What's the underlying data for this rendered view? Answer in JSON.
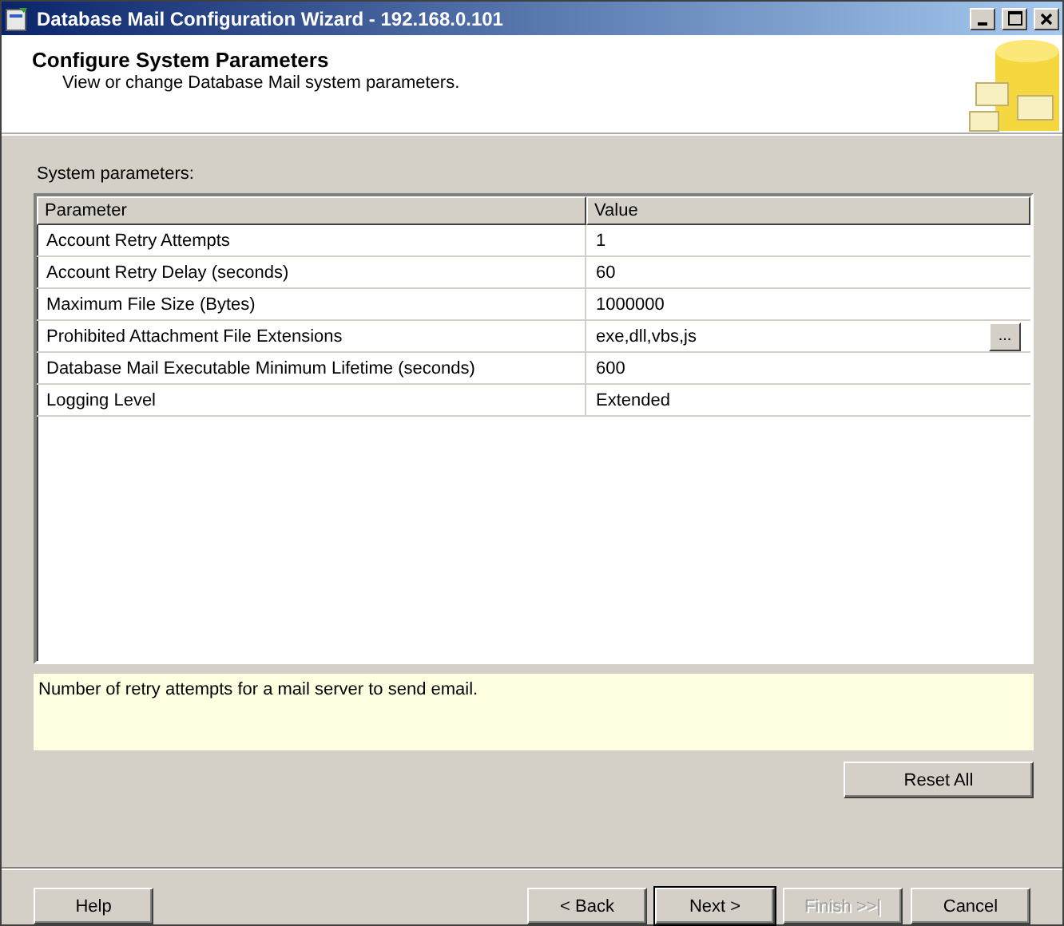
{
  "window": {
    "title": "Database Mail Configuration Wizard - 192.168.0.101"
  },
  "header": {
    "title": "Configure System Parameters",
    "subtitle": "View or change Database Mail system parameters."
  },
  "grid": {
    "label": "System parameters:",
    "columns": [
      "Parameter",
      "Value"
    ],
    "rows": [
      {
        "parameter": "Account Retry Attempts",
        "value": "1"
      },
      {
        "parameter": "Account Retry Delay (seconds)",
        "value": "60"
      },
      {
        "parameter": "Maximum File Size (Bytes)",
        "value": "1000000"
      },
      {
        "parameter": "Prohibited Attachment File Extensions",
        "value": "exe,dll,vbs,js",
        "browse_label": "..."
      },
      {
        "parameter": "Database Mail Executable Minimum Lifetime (seconds)",
        "value": "600"
      },
      {
        "parameter": "Logging Level",
        "value": "Extended"
      }
    ]
  },
  "description": "Number of retry attempts for a mail server to send email.",
  "reset_button": "Reset All",
  "buttons": [
    {
      "label": "Help",
      "disabled": false,
      "default": false
    },
    {
      "label": "< Back",
      "disabled": false,
      "default": false
    },
    {
      "label": "Next >",
      "disabled": false,
      "default": true
    },
    {
      "label": "Finish >>|",
      "disabled": true,
      "default": false
    },
    {
      "label": "Cancel",
      "disabled": false,
      "default": false
    }
  ]
}
